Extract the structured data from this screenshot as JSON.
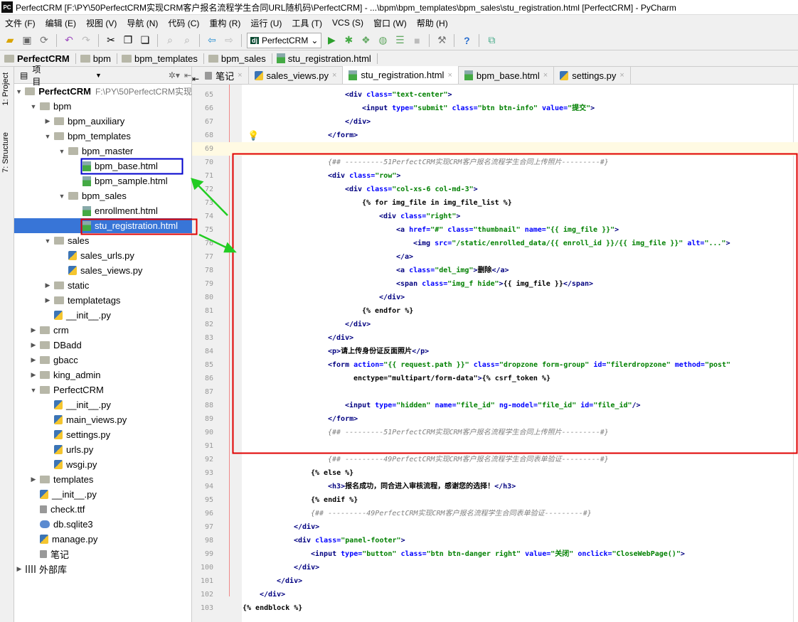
{
  "window": {
    "title": "PerfectCRM [F:\\PY\\50PerfectCRM实现CRM客户报名流程学生合同URL随机码\\PerfectCRM] - ...\\bpm\\bpm_templates\\bpm_sales\\stu_registration.html [PerfectCRM] - PyCharm",
    "logo": "PC"
  },
  "menu": [
    "文件 (F)",
    "编辑 (E)",
    "视图 (V)",
    "导航 (N)",
    "代码 (C)",
    "重构 (R)",
    "运行 (U)",
    "工具 (T)",
    "VCS (S)",
    "窗口 (W)",
    "帮助 (H)"
  ],
  "toolbar": {
    "run_config": "PerfectCRM",
    "dj": "dj"
  },
  "breadcrumb": [
    "PerfectCRM",
    "bpm",
    "bpm_templates",
    "bpm_sales",
    "stu_registration.html"
  ],
  "left_strip": {
    "project": "1: Project",
    "structure": "7: Structure"
  },
  "sidebar": {
    "title": "项目",
    "items": [
      {
        "label": "PerfectCRM",
        "path": "F:\\PY\\50PerfectCRM实现",
        "level": 0,
        "type": "folder",
        "state": "expanded"
      },
      {
        "label": "bpm",
        "level": 1,
        "type": "folder",
        "state": "expanded"
      },
      {
        "label": "bpm_auxiliary",
        "level": 2,
        "type": "folder",
        "state": "collapsed"
      },
      {
        "label": "bpm_templates",
        "level": 2,
        "type": "folder",
        "state": "expanded"
      },
      {
        "label": "bpm_master",
        "level": 3,
        "type": "folder",
        "state": "expanded"
      },
      {
        "label": "bpm_base.html",
        "level": 4,
        "type": "html"
      },
      {
        "label": "bpm_sample.html",
        "level": 4,
        "type": "html"
      },
      {
        "label": "bpm_sales",
        "level": 3,
        "type": "folder",
        "state": "expanded"
      },
      {
        "label": "enrollment.html",
        "level": 4,
        "type": "html"
      },
      {
        "label": "stu_registration.html",
        "level": 4,
        "type": "html",
        "selected": true
      },
      {
        "label": "sales",
        "level": 2,
        "type": "folder",
        "state": "expanded"
      },
      {
        "label": "sales_urls.py",
        "level": 3,
        "type": "py"
      },
      {
        "label": "sales_views.py",
        "level": 3,
        "type": "py"
      },
      {
        "label": "static",
        "level": 2,
        "type": "folder",
        "state": "collapsed"
      },
      {
        "label": "templatetags",
        "level": 2,
        "type": "folder",
        "state": "collapsed"
      },
      {
        "label": "__init__.py",
        "level": 2,
        "type": "py"
      },
      {
        "label": "crm",
        "level": 1,
        "type": "folder",
        "state": "collapsed"
      },
      {
        "label": "DBadd",
        "level": 1,
        "type": "folder",
        "state": "collapsed"
      },
      {
        "label": "gbacc",
        "level": 1,
        "type": "folder",
        "state": "collapsed"
      },
      {
        "label": "king_admin",
        "level": 1,
        "type": "folder",
        "state": "collapsed"
      },
      {
        "label": "PerfectCRM",
        "level": 1,
        "type": "folder",
        "state": "expanded"
      },
      {
        "label": "__init__.py",
        "level": 2,
        "type": "py"
      },
      {
        "label": "main_views.py",
        "level": 2,
        "type": "py"
      },
      {
        "label": "settings.py",
        "level": 2,
        "type": "py"
      },
      {
        "label": "urls.py",
        "level": 2,
        "type": "py"
      },
      {
        "label": "wsgi.py",
        "level": 2,
        "type": "py"
      },
      {
        "label": "templates",
        "level": 1,
        "type": "folder",
        "state": "collapsed"
      },
      {
        "label": "__init__.py",
        "level": 1,
        "type": "py"
      },
      {
        "label": "check.ttf",
        "level": 1,
        "type": "file"
      },
      {
        "label": "db.sqlite3",
        "level": 1,
        "type": "db"
      },
      {
        "label": "manage.py",
        "level": 1,
        "type": "py"
      },
      {
        "label": "笔记",
        "level": 1,
        "type": "file"
      },
      {
        "label": "外部库",
        "level": 0,
        "type": "lib",
        "state": "collapsed"
      }
    ]
  },
  "tabs": [
    {
      "label": "笔记",
      "type": "file"
    },
    {
      "label": "sales_views.py",
      "type": "py"
    },
    {
      "label": "stu_registration.html",
      "type": "html",
      "active": true
    },
    {
      "label": "bpm_base.html",
      "type": "html"
    },
    {
      "label": "settings.py",
      "type": "py"
    }
  ],
  "editor": {
    "lines": [
      {
        "n": "65",
        "i": 24,
        "t": "<div class=\"text-center\">"
      },
      {
        "n": "66",
        "i": 28,
        "t": "<input type=\"submit\" class=\"btn btn-info\" value=\"提交\">"
      },
      {
        "n": "67",
        "i": 24,
        "t": "</div>"
      },
      {
        "n": "68",
        "i": 20,
        "t": "</form>"
      },
      {
        "n": "69",
        "i": 0,
        "t": ""
      },
      {
        "n": "70",
        "i": 20,
        "t": "{## ---------51PerfectCRM实现CRM客户报名流程学生合同上传照片---------#}"
      },
      {
        "n": "71",
        "i": 20,
        "t": "<div class=\"row\">"
      },
      {
        "n": "72",
        "i": 24,
        "t": "<div class=\"col-xs-6 col-md-3\">"
      },
      {
        "n": "73",
        "i": 28,
        "t": "{% for img_file in img_file_list %}"
      },
      {
        "n": "74",
        "i": 32,
        "t": "<div class=\"right\">"
      },
      {
        "n": "75",
        "i": 36,
        "t": "<a href=\"#\" class=\"thumbnail\" name=\"{{ img_file }}\">"
      },
      {
        "n": "76",
        "i": 40,
        "t": "<img src=\"/static/enrolled_data/{{ enroll_id }}/{{ img_file }}\" alt=\"...\">"
      },
      {
        "n": "77",
        "i": 36,
        "t": "</a>"
      },
      {
        "n": "78",
        "i": 36,
        "t": "<a class=\"del_img\">删除</a>"
      },
      {
        "n": "79",
        "i": 36,
        "t": "<span class=\"img_f hide\">{{ img_file }}</span>"
      },
      {
        "n": "80",
        "i": 32,
        "t": "</div>"
      },
      {
        "n": "81",
        "i": 28,
        "t": "{% endfor %}"
      },
      {
        "n": "82",
        "i": 24,
        "t": "</div>"
      },
      {
        "n": "83",
        "i": 20,
        "t": "</div>"
      },
      {
        "n": "84",
        "i": 20,
        "t": "<p>请上传身份证反面照片</p>"
      },
      {
        "n": "85",
        "i": 20,
        "t": "<form action=\"{{ request.path }}\" class=\"dropzone form-group\" id=\"filerdropzone\" method=\"post\""
      },
      {
        "n": "86",
        "i": 26,
        "t": "enctype=\"multipart/form-data\">{% csrf_token %}"
      },
      {
        "n": "87",
        "i": 0,
        "t": ""
      },
      {
        "n": "88",
        "i": 24,
        "t": "<input type=\"hidden\" name=\"file_id\" ng-model=\"file_id\" id=\"file_id\"/>"
      },
      {
        "n": "89",
        "i": 20,
        "t": "</form>"
      },
      {
        "n": "90",
        "i": 20,
        "t": "{## ---------51PerfectCRM实现CRM客户报名流程学生合同上传照片---------#}"
      },
      {
        "n": "91",
        "i": 0,
        "t": ""
      },
      {
        "n": "92",
        "i": 20,
        "t": "{## ---------49PerfectCRM实现CRM客户报名流程学生合同表单验证---------#}"
      },
      {
        "n": "93",
        "i": 16,
        "t": "{% else %}"
      },
      {
        "n": "94",
        "i": 20,
        "t": "<h3>报名成功，同合进入审核流程，感谢您的选择！</h3>"
      },
      {
        "n": "95",
        "i": 16,
        "t": "{% endif %}"
      },
      {
        "n": "96",
        "i": 16,
        "t": "{## ---------49PerfectCRM实现CRM客户报名流程学生合同表单验证---------#}"
      },
      {
        "n": "97",
        "i": 12,
        "t": "</div>"
      },
      {
        "n": "98",
        "i": 12,
        "t": "<div class=\"panel-footer\">"
      },
      {
        "n": "99",
        "i": 16,
        "t": "<input type=\"button\" class=\"btn btn-danger right\" value=\"关闭\" onclick=\"CloseWebPage()\">"
      },
      {
        "n": "100",
        "i": 12,
        "t": "</div>"
      },
      {
        "n": "101",
        "i": 8,
        "t": "</div>"
      },
      {
        "n": "102",
        "i": 4,
        "t": "</div>"
      },
      {
        "n": "103",
        "i": 0,
        "t": "{% endblock %}"
      }
    ]
  },
  "annotations": {
    "red": "#e00000",
    "blue": "#0000cc",
    "green": "#22cc22"
  }
}
